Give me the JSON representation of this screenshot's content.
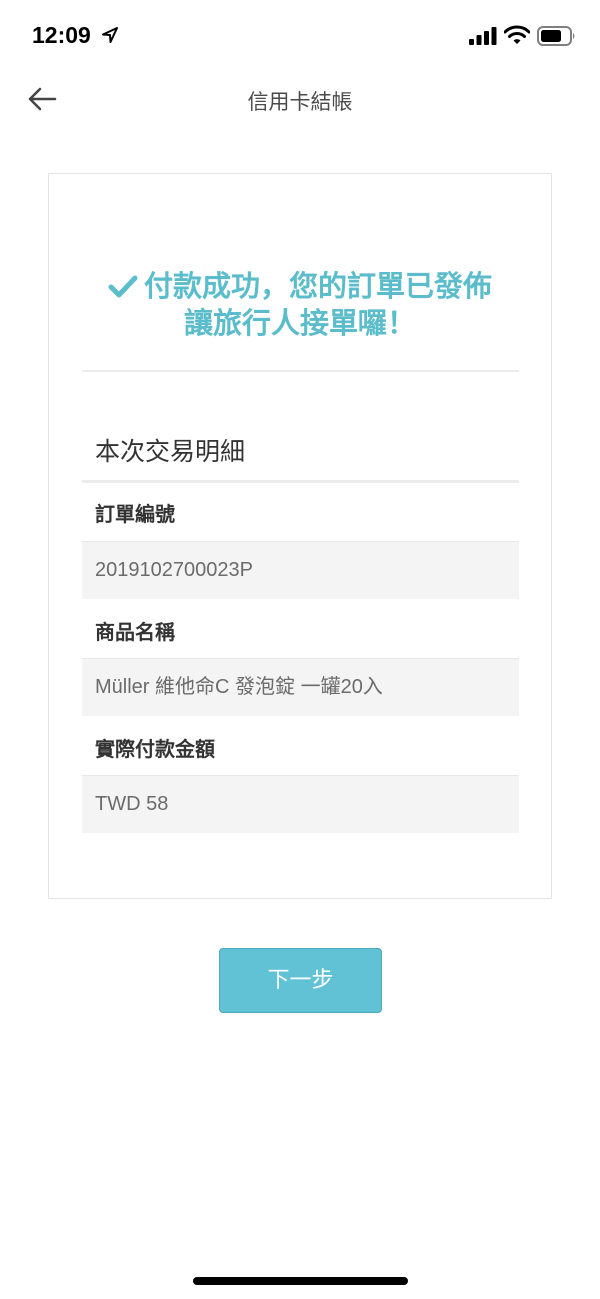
{
  "status_bar": {
    "time": "12:09",
    "icons": [
      "location-arrow-icon",
      "cellular-signal-icon",
      "wifi-icon",
      "battery-icon"
    ]
  },
  "nav": {
    "title": "信用卡結帳",
    "back_icon": "arrow-left-icon"
  },
  "success": {
    "line1": "付款成功，您的訂單已發佈",
    "line2": "讓旅行人接單囉！",
    "icon": "checkmark-icon",
    "color": "#5bbdcb"
  },
  "details": {
    "title": "本次交易明細",
    "order_number_label": "訂單編號",
    "order_number_value": "2019102700023P",
    "product_name_label": "商品名稱",
    "product_name_value": "Müller 維他命C 發泡錠 一罐20入",
    "amount_label": "實際付款金額",
    "amount_value": "TWD 58"
  },
  "actions": {
    "next_label": "下一步",
    "accent_color": "#62c2d5"
  }
}
